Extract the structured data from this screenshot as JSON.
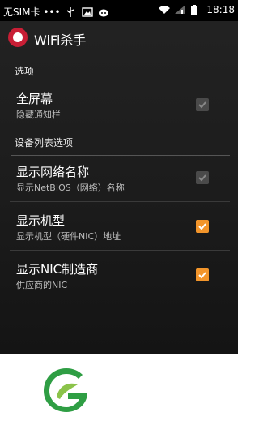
{
  "status_bar": {
    "carrier": "无SIM卡 •••",
    "time": "18:18",
    "icons": [
      "usb-icon",
      "image-icon",
      "notification-icon",
      "wifi-icon",
      "signal-icon",
      "battery-icon"
    ]
  },
  "app": {
    "title": "WiFi杀手",
    "icon": "wifi-killer-app-icon"
  },
  "sections": [
    {
      "header": "选项",
      "items": [
        {
          "title": "全屏幕",
          "subtitle": "隐藏通知栏",
          "checked": true,
          "enabled": false
        }
      ]
    },
    {
      "header": "设备列表选项",
      "items": [
        {
          "title": "显示网络名称",
          "subtitle": "显示NetBIOS（网络）名称",
          "checked": true,
          "enabled": false
        },
        {
          "title": "显示机型",
          "subtitle": "显示机型（硬件NIC）地址",
          "checked": true,
          "enabled": true
        },
        {
          "title": "显示NIC制造商",
          "subtitle": "供应商的NIC",
          "checked": true,
          "enabled": true
        }
      ]
    }
  ],
  "colors": {
    "accent": "#f2952b",
    "disabled_check": "#4a4a4a",
    "background": "#1c1c1c",
    "logo_green": "#2f9e44"
  }
}
